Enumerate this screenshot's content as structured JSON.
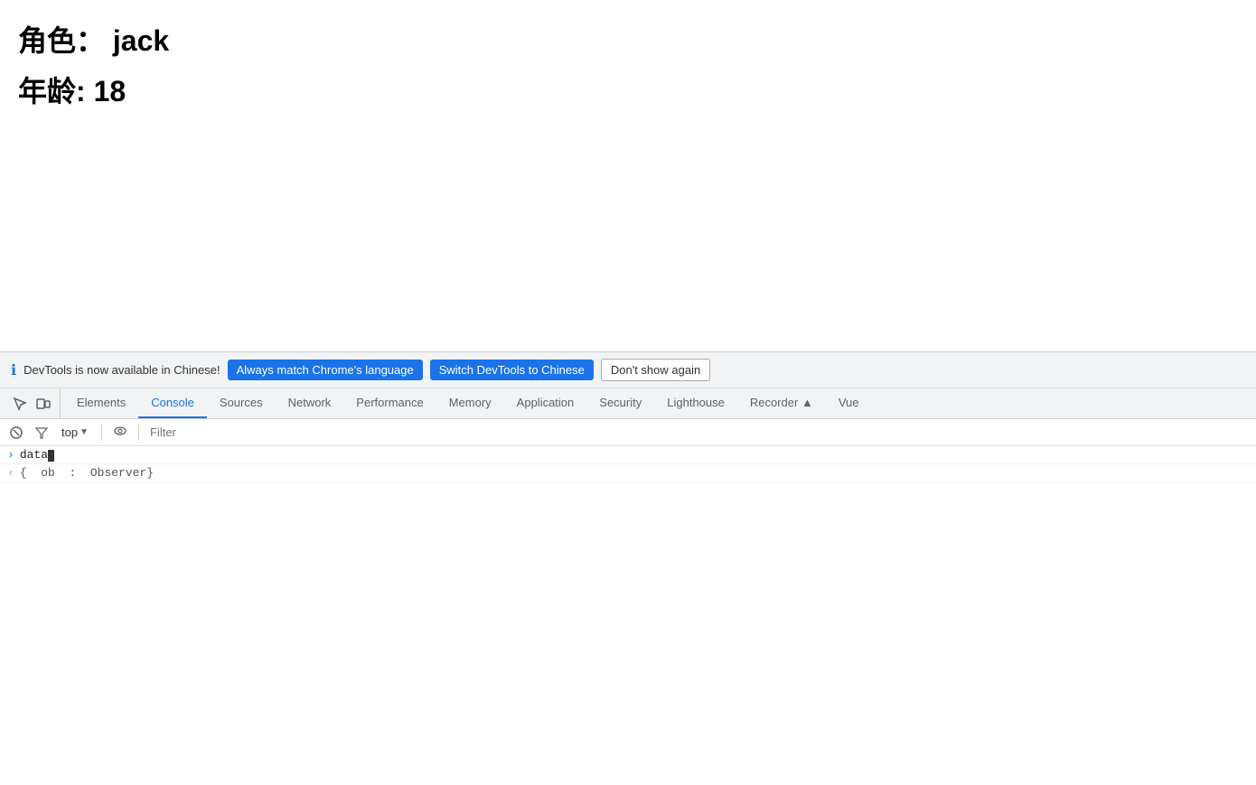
{
  "page": {
    "role_label": "角色：",
    "role_value": "jack",
    "age_label": "年龄:",
    "age_value": "18"
  },
  "devtools": {
    "banner": {
      "info_text": "DevTools is now available in Chinese!",
      "btn_always_match": "Always match Chrome's language",
      "btn_switch": "Switch DevTools to Chinese",
      "btn_dont_show": "Don't show again"
    },
    "tabs": [
      {
        "label": "Elements",
        "active": false
      },
      {
        "label": "Console",
        "active": true
      },
      {
        "label": "Sources",
        "active": false
      },
      {
        "label": "Network",
        "active": false
      },
      {
        "label": "Performance",
        "active": false
      },
      {
        "label": "Memory",
        "active": false
      },
      {
        "label": "Application",
        "active": false
      },
      {
        "label": "Security",
        "active": false
      },
      {
        "label": "Lighthouse",
        "active": false
      },
      {
        "label": "Recorder 🔴",
        "active": false
      },
      {
        "label": "Vue",
        "active": false
      }
    ],
    "console": {
      "top_selector": "top",
      "filter_placeholder": "Filter",
      "input_text": "data",
      "output_text": "< {  ob  :  Observer}"
    }
  }
}
